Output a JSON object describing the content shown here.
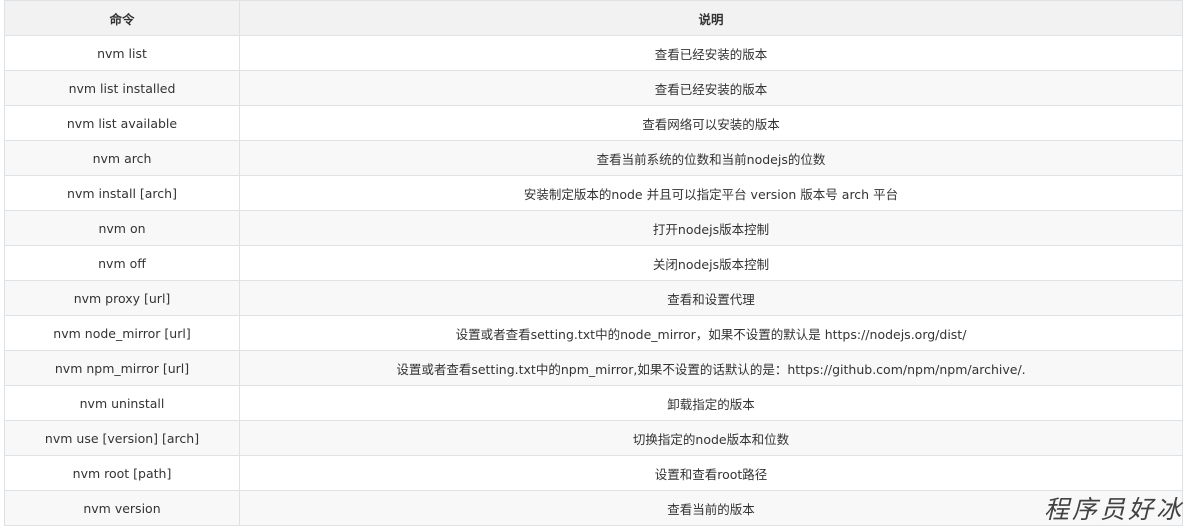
{
  "table": {
    "headers": [
      "命令",
      "说明"
    ],
    "rows": [
      [
        "nvm list",
        "查看已经安装的版本"
      ],
      [
        "nvm list installed",
        "查看已经安装的版本"
      ],
      [
        "nvm list available",
        "查看网络可以安装的版本"
      ],
      [
        "nvm arch",
        "查看当前系统的位数和当前nodejs的位数"
      ],
      [
        "nvm install [arch]",
        "安装制定版本的node 并且可以指定平台 version 版本号 arch 平台"
      ],
      [
        "nvm on",
        "打开nodejs版本控制"
      ],
      [
        "nvm off",
        "关闭nodejs版本控制"
      ],
      [
        "nvm proxy [url]",
        "查看和设置代理"
      ],
      [
        "nvm node_mirror [url]",
        "设置或者查看setting.txt中的node_mirror，如果不设置的默认是 https://nodejs.org/dist/"
      ],
      [
        "nvm npm_mirror [url]",
        "设置或者查看setting.txt中的npm_mirror,如果不设置的话默认的是：https://github.com/npm/npm/archive/."
      ],
      [
        "nvm uninstall",
        "卸载指定的版本"
      ],
      [
        "nvm use [version] [arch]",
        "切换指定的node版本和位数"
      ],
      [
        "nvm root [path]",
        "设置和查看root路径"
      ],
      [
        "nvm version",
        "查看当前的版本"
      ]
    ]
  },
  "watermark": "程序员好冰"
}
